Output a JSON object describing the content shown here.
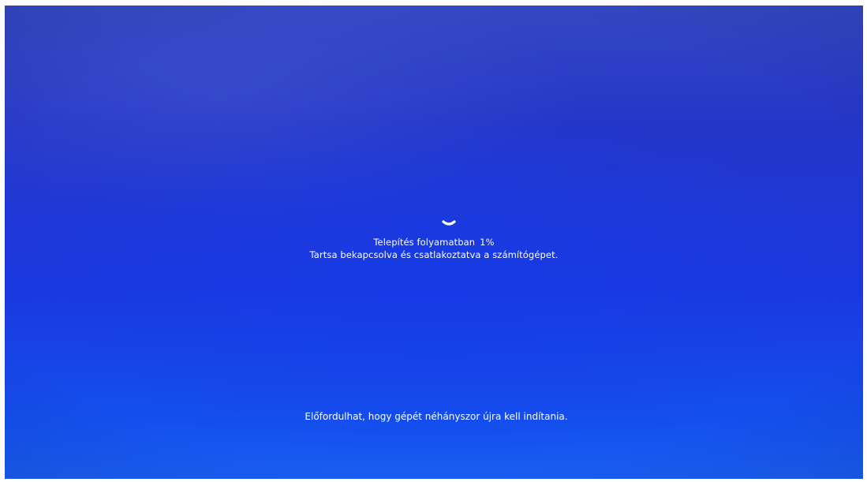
{
  "install_screen": {
    "status": {
      "title": "Telepítés folyamatban",
      "percent_label": "1%",
      "progress_percent": 1,
      "message": "Tartsa bekapcsolva és csatlakoztatva a számítógépet."
    },
    "footer_note": "Előfordulhat, hogy gépét néhányszor újra kell indítania.",
    "spinner_icon": "loading-spinner-icon",
    "colors": {
      "background_top": "#3448c2",
      "background_bottom": "#1a5ef2",
      "text": "#ffffff"
    }
  }
}
